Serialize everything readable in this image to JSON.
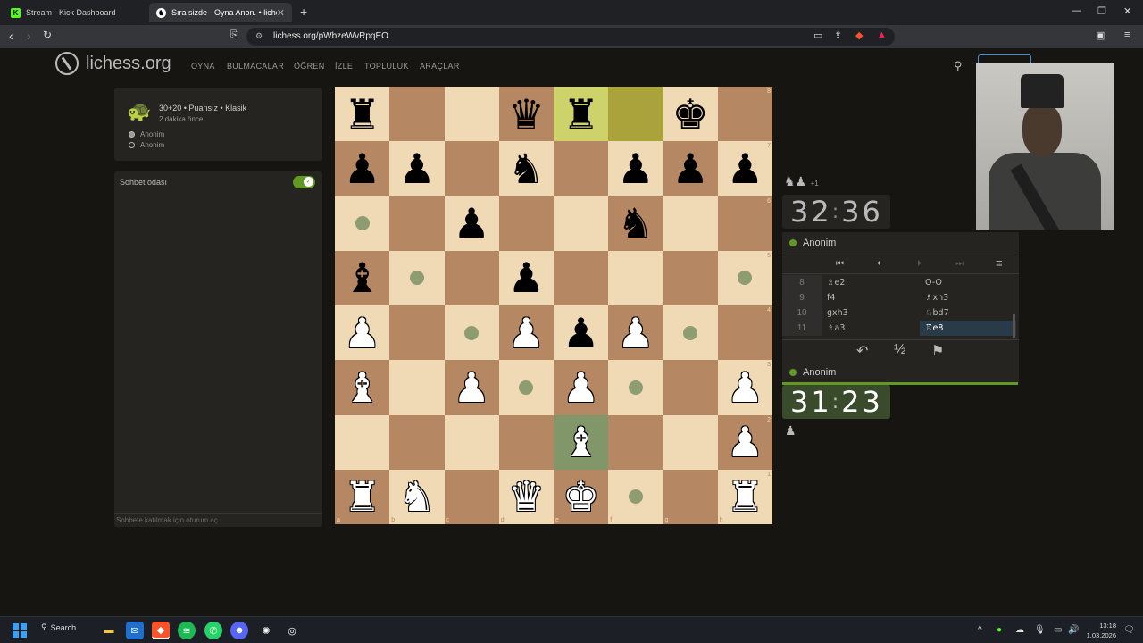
{
  "browser": {
    "tabs": [
      {
        "label": "Stream - Kick Dashboard",
        "favicon": "K",
        "active": false
      },
      {
        "label": "Sıra sizde - Oyna Anon. • liches",
        "favicon": "♞",
        "active": true
      }
    ],
    "new_tab": "+",
    "url": "lichess.org/pWbzeWvRpqEO",
    "window_controls": {
      "minimize": "—",
      "restore": "❐",
      "close": "✕"
    }
  },
  "site": {
    "logo_text": "lichess.org",
    "nav": [
      "OYNA",
      "BULMACALAR",
      "ÖĞREN",
      "İZLE",
      "TOPLULUK",
      "ARAÇLAR"
    ]
  },
  "game_info": {
    "variant": "30+20 • Puansız • Klasik",
    "time_ago": "2 dakika önce",
    "players": [
      {
        "name": "Anonim",
        "color": "white"
      },
      {
        "name": "Anonim",
        "color": "black"
      }
    ]
  },
  "chat": {
    "title": "Sohbet odası",
    "input_placeholder": "Sohbete katılmak için oturum aç"
  },
  "board": {
    "files": [
      "a",
      "b",
      "c",
      "d",
      "e",
      "f",
      "g",
      "h"
    ],
    "ranks": [
      "8",
      "7",
      "6",
      "5",
      "4",
      "3",
      "2",
      "1"
    ],
    "squares": [
      [
        "bR",
        "",
        "",
        "bQ",
        "bR",
        "",
        "bK",
        ""
      ],
      [
        "bP",
        "bP",
        "",
        "bN",
        "",
        "bP",
        "bP",
        "bP"
      ],
      [
        "",
        "",
        "bP",
        "",
        "",
        "bN",
        "",
        ""
      ],
      [
        "bB",
        "",
        "",
        "bP",
        "",
        "",
        "",
        ""
      ],
      [
        "wP",
        "",
        "",
        "wP",
        "bP",
        "wP",
        "",
        ""
      ],
      [
        "wB",
        "",
        "wP",
        "",
        "wP",
        "",
        "",
        "wP"
      ],
      [
        "",
        "",
        "",
        "",
        "wB",
        "",
        "",
        "wP"
      ],
      [
        "wR",
        "wN",
        "",
        "wQ",
        "wK",
        "",
        "",
        "wR"
      ]
    ],
    "last_move": [
      "e8",
      "f8"
    ],
    "selected": "e2",
    "move_dots": [
      "a6",
      "b5",
      "h5",
      "c4",
      "g4",
      "d3",
      "f3",
      "f1"
    ]
  },
  "right_panel": {
    "material_top": "♞♟",
    "material_top_diff": "+1",
    "clock_top": {
      "min": "32",
      "sec": "36"
    },
    "player_top": "Anonim",
    "moves": [
      {
        "n": "8",
        "white": "♗e2",
        "black": "O-O"
      },
      {
        "n": "9",
        "white": "f4",
        "black": "♗xh3"
      },
      {
        "n": "10",
        "white": "gxh3",
        "black": "♘bd7"
      },
      {
        "n": "11",
        "white": "♗a3",
        "black": "♖e8"
      }
    ],
    "controls": {
      "first": "⏮",
      "prev": "⏴",
      "next": "⏵",
      "last": "⏭",
      "menu": "≡"
    },
    "actions": {
      "takeback": "↶",
      "draw": "½",
      "resign": "⚑"
    },
    "player_bottom": "Anonim",
    "clock_bottom": {
      "min": "31",
      "sec": "23"
    },
    "material_bottom": "♟"
  },
  "taskbar": {
    "search": "Search",
    "time": "13:18",
    "date": "1.03.2026"
  }
}
